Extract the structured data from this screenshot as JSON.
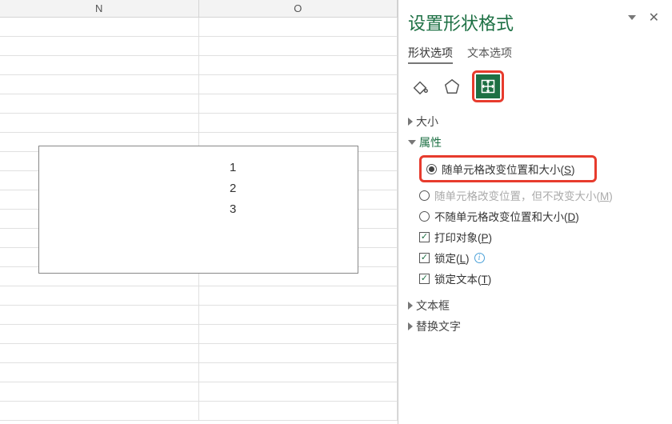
{
  "columns": [
    "N",
    "O"
  ],
  "shape_text_lines": [
    "1",
    "2",
    "3"
  ],
  "panel": {
    "title": "设置形状格式",
    "tabs": {
      "shape": "形状选项",
      "text": "文本选项"
    },
    "icons": {
      "fill": "fill-effects-icon",
      "effects": "shape-effects-icon",
      "size": "size-properties-icon"
    },
    "sections": {
      "size": {
        "label": "大小",
        "expanded": false
      },
      "properties": {
        "label": "属性",
        "expanded": true,
        "options": {
          "move_size": "随单元格改变位置和大小(",
          "move_size_key": "S",
          "move_nosize": "随单元格改变位置，但不改变大小(",
          "move_nosize_key": "M",
          "no_move": "不随单元格改变位置和大小(",
          "no_move_key": "D",
          "print": "打印对象(",
          "print_key": "P",
          "locked": "锁定(",
          "locked_key": "L",
          "lock_text": "锁定文本(",
          "lock_text_key": "T",
          "close_paren": ")"
        },
        "state": {
          "positioning": "move_size",
          "print": true,
          "locked": true,
          "lock_text": true
        }
      },
      "textbox": {
        "label": "文本框",
        "expanded": false
      },
      "alt_text": {
        "label": "替换文字",
        "expanded": false
      }
    }
  }
}
